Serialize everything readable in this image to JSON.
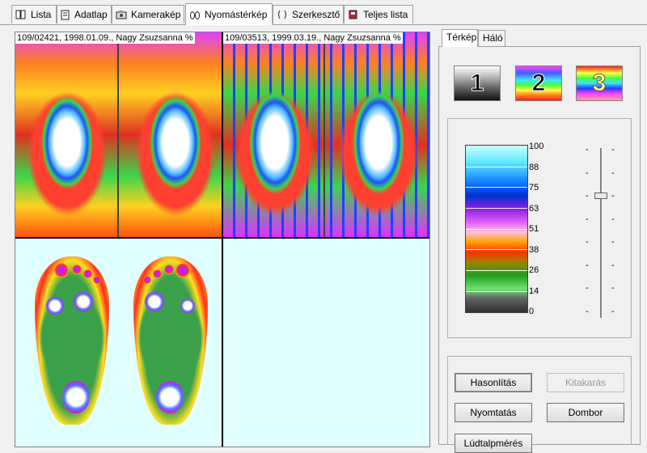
{
  "tabs": [
    {
      "label": "Lista",
      "icon": "book-icon"
    },
    {
      "label": "Adatlap",
      "icon": "document-icon"
    },
    {
      "label": "Kamerakép",
      "icon": "camera-icon"
    },
    {
      "label": "Nyomástérkép",
      "icon": "footprint-icon",
      "active": true
    },
    {
      "label": "Szerkesztő",
      "icon": "edit-brackets-icon"
    },
    {
      "label": "Teljes lista",
      "icon": "list-book-icon"
    }
  ],
  "viewer": {
    "scan_1_label": "109/02421, 1998.01.09., Nagy Zsuzsanna %",
    "scan_2_label": "109/03513, 1999.03.19., Nagy Zsuzsanna %"
  },
  "side": {
    "subtabs": [
      "Térkép",
      "Háló"
    ],
    "palette_buttons": [
      "1",
      "2",
      "3"
    ],
    "scale_ticks": [
      "100",
      "88",
      "75",
      "63",
      "51",
      "38",
      "26",
      "14",
      "0"
    ],
    "slider_level_percent": 72,
    "buttons": {
      "compare": "Hasonlítás",
      "mask": "Kitakarás",
      "print": "Nyomtatás",
      "relief": "Dombor",
      "flatfoot": "Lúdtalpmérés"
    }
  },
  "colors": {
    "window_bg": "#f0f0f0",
    "map_bg": "#e0ffff",
    "disabled_text": "#9a9a9a"
  }
}
